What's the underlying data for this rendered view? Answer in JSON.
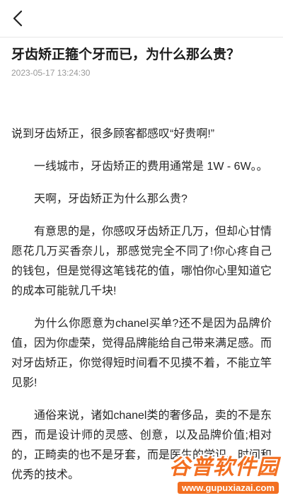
{
  "header": {
    "back_icon": "chevron-left-icon"
  },
  "article": {
    "title": "牙齿矫正箍个牙而已，为什么那么贵？",
    "timestamp": "2023-05-17 13:24:30",
    "paragraphs": [
      "说到牙齿矫正，很多顾客都感叹“好贵啊!”",
      "一线城市，牙齿矫正的费用通常是 1W - 6W。。",
      "天啊，牙齿矫正为什么那么贵?",
      "有意思的是，你感叹牙齿矫正几万，但却心甘情愿花几万买香奈儿，那感觉完全不同了!你心疼自己的钱包，但是觉得这笔钱花的值，哪怕你心里知道它的成本可能就几千块!",
      "为什么你愿意为chanel买单?还不是因为品牌价值，因为你虚荣，觉得品牌能给自己带来满足感。而对牙齿矫正，你觉得短时间看不见摸不着，不能立竿见影!",
      "通俗来说，诸如chanel类的奢侈品，卖的不是东西，而是设计师的灵感、创意，以及品牌价值;相对的，正畸卖的也不是牙套，而是医生的学识、时间和优秀的技术。"
    ]
  },
  "watermark": {
    "name": "谷普软件园",
    "url": "www.gupuxiazai.com",
    "color": "#f36f21"
  }
}
